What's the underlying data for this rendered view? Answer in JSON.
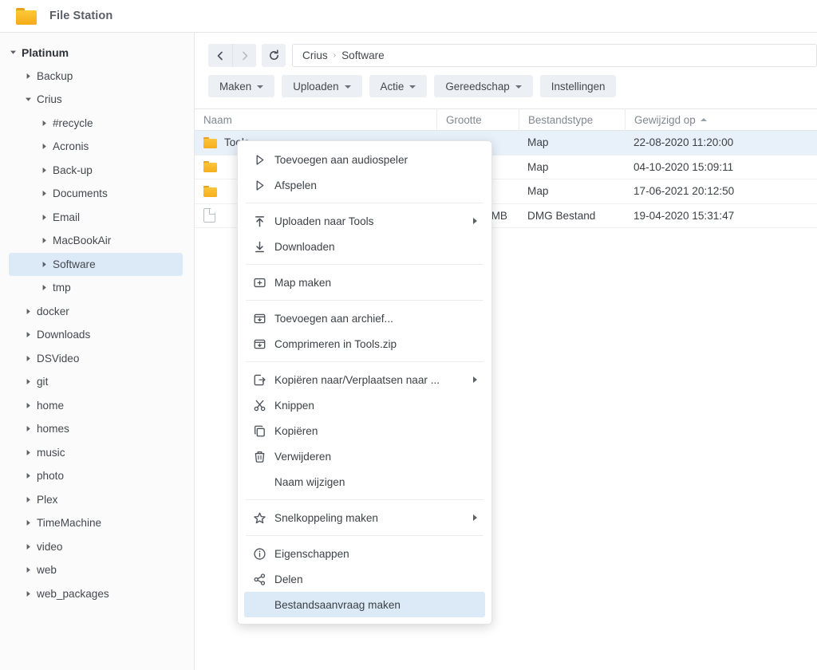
{
  "window": {
    "title": "File Station",
    "icon": "folder-icon"
  },
  "sidebar": {
    "items": [
      {
        "label": "Platinum",
        "level": 0,
        "caret": "down",
        "root": true,
        "selected": false
      },
      {
        "label": "Backup",
        "level": 1,
        "caret": "right",
        "root": false,
        "selected": false
      },
      {
        "label": "Crius",
        "level": 1,
        "caret": "down",
        "root": false,
        "selected": false
      },
      {
        "label": "#recycle",
        "level": 2,
        "caret": "right",
        "root": false,
        "selected": false
      },
      {
        "label": "Acronis",
        "level": 2,
        "caret": "right",
        "root": false,
        "selected": false
      },
      {
        "label": "Back-up",
        "level": 2,
        "caret": "right",
        "root": false,
        "selected": false
      },
      {
        "label": "Documents",
        "level": 2,
        "caret": "right",
        "root": false,
        "selected": false
      },
      {
        "label": "Email",
        "level": 2,
        "caret": "right",
        "root": false,
        "selected": false
      },
      {
        "label": "MacBookAir",
        "level": 2,
        "caret": "right",
        "root": false,
        "selected": false
      },
      {
        "label": "Software",
        "level": 2,
        "caret": "right",
        "root": false,
        "selected": true
      },
      {
        "label": "tmp",
        "level": 2,
        "caret": "right",
        "root": false,
        "selected": false
      },
      {
        "label": "docker",
        "level": 1,
        "caret": "right",
        "root": false,
        "selected": false
      },
      {
        "label": "Downloads",
        "level": 1,
        "caret": "right",
        "root": false,
        "selected": false
      },
      {
        "label": "DSVideo",
        "level": 1,
        "caret": "right",
        "root": false,
        "selected": false
      },
      {
        "label": "git",
        "level": 1,
        "caret": "right",
        "root": false,
        "selected": false
      },
      {
        "label": "home",
        "level": 1,
        "caret": "right",
        "root": false,
        "selected": false
      },
      {
        "label": "homes",
        "level": 1,
        "caret": "right",
        "root": false,
        "selected": false
      },
      {
        "label": "music",
        "level": 1,
        "caret": "right",
        "root": false,
        "selected": false
      },
      {
        "label": "photo",
        "level": 1,
        "caret": "right",
        "root": false,
        "selected": false
      },
      {
        "label": "Plex",
        "level": 1,
        "caret": "right",
        "root": false,
        "selected": false
      },
      {
        "label": "TimeMachine",
        "level": 1,
        "caret": "right",
        "root": false,
        "selected": false
      },
      {
        "label": "video",
        "level": 1,
        "caret": "right",
        "root": false,
        "selected": false
      },
      {
        "label": "web",
        "level": 1,
        "caret": "right",
        "root": false,
        "selected": false
      },
      {
        "label": "web_packages",
        "level": 1,
        "caret": "right",
        "root": false,
        "selected": false
      }
    ]
  },
  "toolbar": {
    "back_icon": "chevron-left-icon",
    "forward_icon": "chevron-right-icon",
    "refresh_icon": "refresh-icon",
    "breadcrumb": {
      "root": "Crius",
      "separator": "›",
      "current": "Software"
    },
    "buttons": [
      {
        "label": "Maken",
        "dropdown": true
      },
      {
        "label": "Uploaden",
        "dropdown": true
      },
      {
        "label": "Actie",
        "dropdown": true
      },
      {
        "label": "Gereedschap",
        "dropdown": true
      },
      {
        "label": "Instellingen",
        "dropdown": false
      }
    ]
  },
  "table": {
    "columns": [
      {
        "key": "name",
        "label": "Naam",
        "sorted": false
      },
      {
        "key": "size",
        "label": "Grootte",
        "sorted": false
      },
      {
        "key": "type",
        "label": "Bestandstype",
        "sorted": false
      },
      {
        "key": "mod",
        "label": "Gewijzigd op",
        "sorted": true,
        "sort_dir": "asc"
      }
    ],
    "rows": [
      {
        "name": "Tools",
        "icon": "folder-icon",
        "size": "",
        "type": "Map",
        "modified": "22-08-2020 11:20:00",
        "selected": true
      },
      {
        "name": "",
        "icon": "folder-icon",
        "size": "",
        "type": "Map",
        "modified": "04-10-2020 15:09:11",
        "selected": false
      },
      {
        "name": "",
        "icon": "folder-icon",
        "size": "",
        "type": "Map",
        "modified": "17-06-2021 20:12:50",
        "selected": false
      },
      {
        "name": "",
        "icon": "file-icon",
        "size": "MB",
        "type": "DMG Bestand",
        "modified": "19-04-2020 15:31:47",
        "selected": false
      }
    ]
  },
  "context_menu": {
    "groups": [
      [
        {
          "label": "Toevoegen aan audiospeler",
          "icon": "play-outline-icon",
          "submenu": false,
          "highlight": false
        },
        {
          "label": "Afspelen",
          "icon": "play-outline-icon",
          "submenu": false,
          "highlight": false
        }
      ],
      [
        {
          "label": "Uploaden naar Tools",
          "icon": "upload-icon",
          "submenu": true,
          "highlight": false
        },
        {
          "label": "Downloaden",
          "icon": "download-icon",
          "submenu": false,
          "highlight": false
        }
      ],
      [
        {
          "label": "Map maken",
          "icon": "new-folder-icon",
          "submenu": false,
          "highlight": false
        }
      ],
      [
        {
          "label": "Toevoegen aan archief...",
          "icon": "archive-icon",
          "submenu": false,
          "highlight": false
        },
        {
          "label": "Comprimeren in Tools.zip",
          "icon": "archive-icon",
          "submenu": false,
          "highlight": false
        }
      ],
      [
        {
          "label": "Kopiëren naar/Verplaatsen naar ...",
          "icon": "move-to-icon",
          "submenu": true,
          "highlight": false
        },
        {
          "label": "Knippen",
          "icon": "scissors-icon",
          "submenu": false,
          "highlight": false
        },
        {
          "label": "Kopiëren",
          "icon": "copy-icon",
          "submenu": false,
          "highlight": false
        },
        {
          "label": "Verwijderen",
          "icon": "trash-icon",
          "submenu": false,
          "highlight": false
        },
        {
          "label": "Naam wijzigen",
          "icon": "none",
          "submenu": false,
          "highlight": false
        }
      ],
      [
        {
          "label": "Snelkoppeling maken",
          "icon": "star-icon",
          "submenu": true,
          "highlight": false
        }
      ],
      [
        {
          "label": "Eigenschappen",
          "icon": "info-icon",
          "submenu": false,
          "highlight": false
        },
        {
          "label": "Delen",
          "icon": "share-icon",
          "submenu": false,
          "highlight": false
        },
        {
          "label": "Bestandsaanvraag maken",
          "icon": "none",
          "submenu": false,
          "highlight": true
        }
      ]
    ]
  },
  "colors": {
    "selection_blue": "#dceaf7",
    "row_selection": "#e8f1fa",
    "folder_yellow": "#f6ae1c",
    "toolbar_grey": "#eceff3",
    "text": "#3c4146"
  }
}
